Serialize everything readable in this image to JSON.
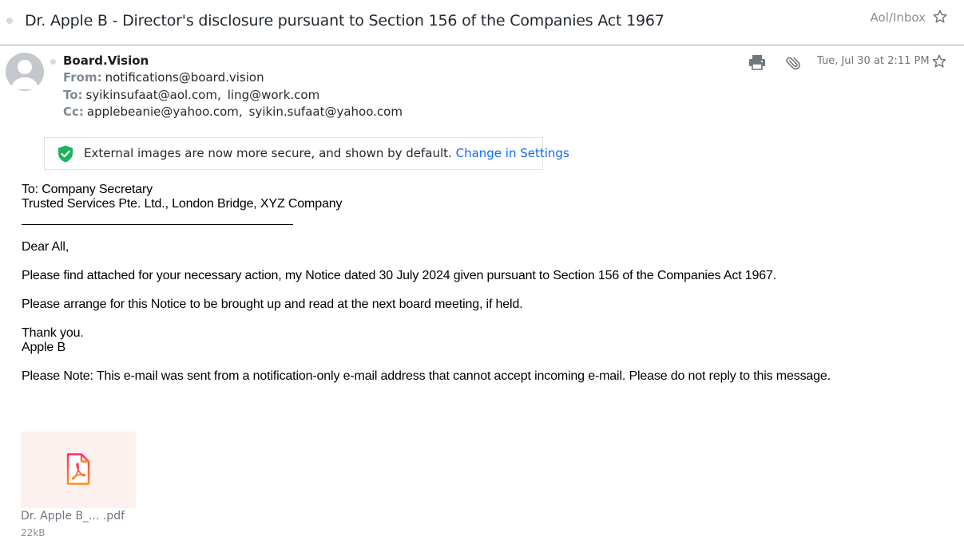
{
  "subject": {
    "title": "Dr. Apple B - Director's disclosure pursuant to Section 156 of the Companies Act 1967",
    "folder": "Aol/Inbox"
  },
  "header": {
    "sender_name": "Board.Vision",
    "from_label": "From:",
    "from_value": "notifications@board.vision",
    "to_label": "To:",
    "to_values": [
      "syikinsufaat@aol.com,",
      "ling@work.com"
    ],
    "cc_label": "Cc:",
    "cc_values": [
      "applebeanie@yahoo.com,",
      "syikin.sufaat@yahoo.com"
    ],
    "date": "Tue, Jul 30 at 2:11 PM"
  },
  "notice": {
    "text": "External images are now more secure, and shown by default.",
    "link": "Change in Settings"
  },
  "body": {
    "to_line": "To: Company Secretary",
    "company_line": "Trusted Services Pte. Ltd., London Bridge, XYZ Company",
    "greeting": "Dear All,",
    "paragraph1": "Please find attached for your necessary action, my Notice dated 30 July 2024 given pursuant to Section 156 of the Companies Act 1967.",
    "paragraph2": "Please arrange for this Notice to be brought up and read at the next board meeting, if held.",
    "thanks": "Thank you.",
    "signature": "Apple B",
    "note": "Please Note: This e-mail was sent from a notification-only e-mail address that cannot accept incoming e-mail. Please do not reply to this message."
  },
  "attachment": {
    "name": "Dr. Apple B_...  .pdf",
    "size": "22kB"
  },
  "icons": {
    "star": "star-outline-icon",
    "print": "printer-icon",
    "attach": "paperclip-icon",
    "shield": "shield-check-icon",
    "pdf": "pdf-file-icon"
  },
  "colors": {
    "link": "#0f69ff",
    "shield": "#1fb35b",
    "pdf_accent": "#f6393a",
    "attachment_bg": "#fdf1f0"
  }
}
